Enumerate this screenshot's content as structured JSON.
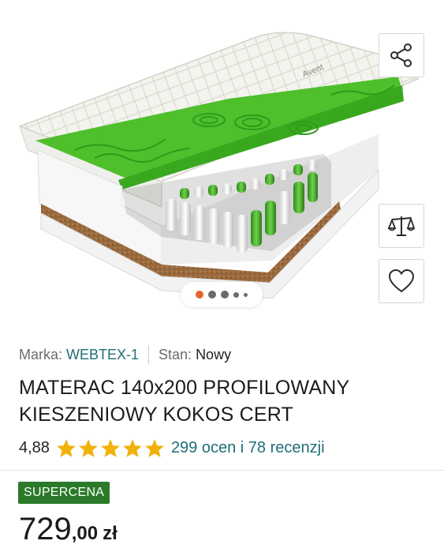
{
  "product": {
    "brand_label": "Marka:",
    "brand_value": "WEBTEX-1",
    "condition_label": "Stan:",
    "condition_value": "Nowy",
    "title": "MATERAC 140x200 PROFILOWANY KIESZENIOWY KOKOS CERT",
    "rating_score": "4,88",
    "rating_stars": 5,
    "rating_text": "299 ocen i 78 recenzji",
    "badge": "SUPERCENA",
    "price_integer": "729",
    "price_decimal": ",00",
    "price_currency": "zł"
  },
  "gallery": {
    "image_alt_icon": "mattress-product-photo",
    "slide_count": 5,
    "active_slide": 1,
    "mattress_print": "Avent"
  },
  "actions": {
    "share_icon": "share-icon",
    "compare_icon": "scales-compare-icon",
    "favorite_icon": "heart-icon"
  },
  "colors": {
    "accent_link": "#1f6e77",
    "badge_green": "#2a7a2a",
    "star": "#f2b20c",
    "active_dot": "#e4662c",
    "foam_green": "#4fbf2c"
  }
}
